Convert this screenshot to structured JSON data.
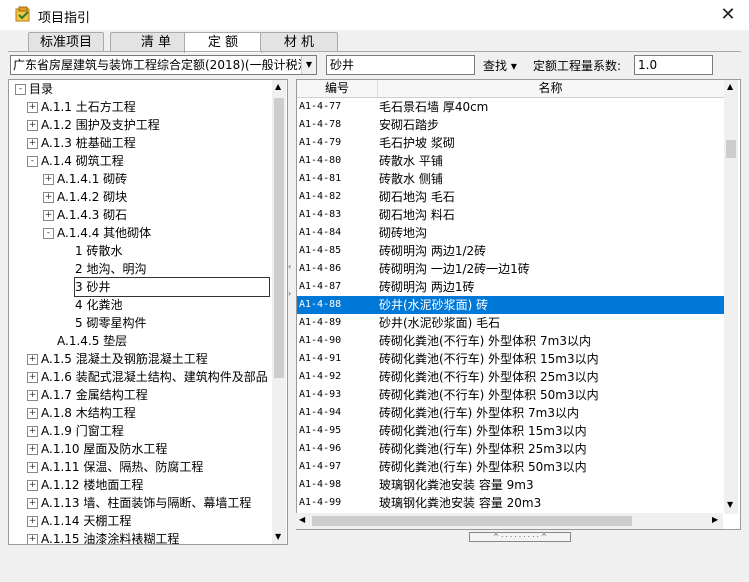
{
  "window": {
    "title": "项目指引",
    "close_glyph": "✕"
  },
  "tabs": [
    {
      "label": "标准项目",
      "active": false
    },
    {
      "label": "清 单",
      "active": false
    },
    {
      "label": "定 额",
      "active": true
    },
    {
      "label": "材 机",
      "active": false
    }
  ],
  "toolbar": {
    "quota_library": "广东省房屋建筑与装饰工程综合定额(2018)(一般计税法)",
    "search_value": "砂井",
    "search_button": "查找 ▾",
    "coef_label": "定额工程量系数:",
    "coef_value": "1.0"
  },
  "tree": [
    {
      "label": "目录",
      "expander": "-",
      "level": 0
    },
    {
      "label": "A.1.1 土石方工程",
      "expander": "+",
      "level": 1
    },
    {
      "label": "A.1.2 围护及支护工程",
      "expander": "+",
      "level": 1
    },
    {
      "label": "A.1.3 桩基础工程",
      "expander": "+",
      "level": 1
    },
    {
      "label": "A.1.4 砌筑工程",
      "expander": "-",
      "level": 1
    },
    {
      "label": "A.1.4.1 砌砖",
      "expander": "+",
      "level": 2
    },
    {
      "label": "A.1.4.2 砌块",
      "expander": "+",
      "level": 2
    },
    {
      "label": "A.1.4.3 砌石",
      "expander": "+",
      "level": 2
    },
    {
      "label": "A.1.4.4 其他砌体",
      "expander": "-",
      "level": 2
    },
    {
      "label": "1 砖散水",
      "expander": "",
      "level": 3
    },
    {
      "label": "2 地沟、明沟",
      "expander": "",
      "level": 3
    },
    {
      "label": "3 砂井",
      "expander": "",
      "level": 3,
      "selected": true
    },
    {
      "label": "4 化粪池",
      "expander": "",
      "level": 3
    },
    {
      "label": "5 砌零星构件",
      "expander": "",
      "level": 3
    },
    {
      "label": "A.1.4.5 垫层",
      "expander": "",
      "level": 2
    },
    {
      "label": "A.1.5 混凝土及钢筋混凝土工程",
      "expander": "+",
      "level": 1
    },
    {
      "label": "A.1.6 装配式混凝土结构、建筑构件及部品",
      "expander": "+",
      "level": 1
    },
    {
      "label": "A.1.7 金属结构工程",
      "expander": "+",
      "level": 1
    },
    {
      "label": "A.1.8 木结构工程",
      "expander": "+",
      "level": 1
    },
    {
      "label": "A.1.9 门窗工程",
      "expander": "+",
      "level": 1
    },
    {
      "label": "A.1.10 屋面及防水工程",
      "expander": "+",
      "level": 1
    },
    {
      "label": "A.1.11 保温、隔热、防腐工程",
      "expander": "+",
      "level": 1
    },
    {
      "label": "A.1.12 楼地面工程",
      "expander": "+",
      "level": 1
    },
    {
      "label": "A.1.13 墙、柱面装饰与隔断、幕墙工程",
      "expander": "+",
      "level": 1
    },
    {
      "label": "A.1.14 天棚工程",
      "expander": "+",
      "level": 1
    },
    {
      "label": "A.1.15 油漆涂料裱糊工程",
      "expander": "+",
      "level": 1
    }
  ],
  "grid": {
    "columns": [
      "编号",
      "名称"
    ],
    "rows": [
      {
        "code": "A1-4-77",
        "name": "毛石景石墙 厚40cm"
      },
      {
        "code": "A1-4-78",
        "name": "安砌石踏步"
      },
      {
        "code": "A1-4-79",
        "name": "毛石护坡 浆砌"
      },
      {
        "code": "A1-4-80",
        "name": "砖散水 平铺"
      },
      {
        "code": "A1-4-81",
        "name": "砖散水 侧铺"
      },
      {
        "code": "A1-4-82",
        "name": "砌石地沟 毛石"
      },
      {
        "code": "A1-4-83",
        "name": "砌石地沟 料石"
      },
      {
        "code": "A1-4-84",
        "name": "砌砖地沟"
      },
      {
        "code": "A1-4-85",
        "name": "砖砌明沟 两边1/2砖"
      },
      {
        "code": "A1-4-86",
        "name": "砖砌明沟 一边1/2砖一边1砖"
      },
      {
        "code": "A1-4-87",
        "name": "砖砌明沟 两边1砖"
      },
      {
        "code": "A1-4-88",
        "name": "砂井(水泥砂浆面) 砖",
        "selected": true
      },
      {
        "code": "A1-4-89",
        "name": "砂井(水泥砂浆面) 毛石"
      },
      {
        "code": "A1-4-90",
        "name": "砖砌化粪池(不行车) 外型体积 7m3以内"
      },
      {
        "code": "A1-4-91",
        "name": "砖砌化粪池(不行车) 外型体积 15m3以内"
      },
      {
        "code": "A1-4-92",
        "name": "砖砌化粪池(不行车) 外型体积 25m3以内"
      },
      {
        "code": "A1-4-93",
        "name": "砖砌化粪池(不行车) 外型体积 50m3以内"
      },
      {
        "code": "A1-4-94",
        "name": "砖砌化粪池(行车) 外型体积 7m3以内"
      },
      {
        "code": "A1-4-95",
        "name": "砖砌化粪池(行车) 外型体积 15m3以内"
      },
      {
        "code": "A1-4-96",
        "name": "砖砌化粪池(行车) 外型体积 25m3以内"
      },
      {
        "code": "A1-4-97",
        "name": "砖砌化粪池(行车) 外型体积 50m3以内"
      },
      {
        "code": "A1-4-98",
        "name": "玻璃钢化粪池安装 容量 9m3"
      },
      {
        "code": "A1-4-99",
        "name": "玻璃钢化粪池安装 容量 20m3"
      }
    ]
  },
  "colors": {
    "selection": "#0078d7",
    "background": "#f0f0f0"
  }
}
